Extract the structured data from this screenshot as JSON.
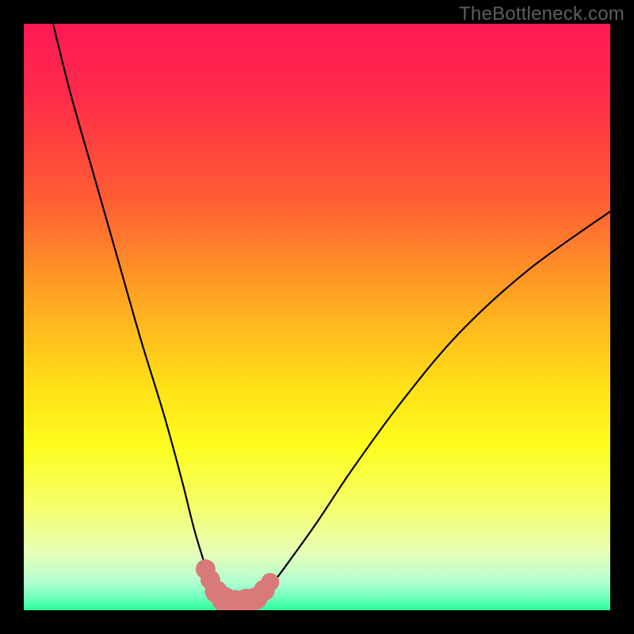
{
  "watermark": "TheBottleneck.com",
  "colors": {
    "frame": "#000000",
    "gradient_stops": [
      {
        "offset": 0.0,
        "color": "#ff1a55"
      },
      {
        "offset": 0.12,
        "color": "#ff2b4a"
      },
      {
        "offset": 0.3,
        "color": "#ff5d33"
      },
      {
        "offset": 0.5,
        "color": "#ffb31f"
      },
      {
        "offset": 0.62,
        "color": "#ffe018"
      },
      {
        "offset": 0.72,
        "color": "#fdfd1e"
      },
      {
        "offset": 0.82,
        "color": "#f5ff68"
      },
      {
        "offset": 0.9,
        "color": "#e6ffb8"
      },
      {
        "offset": 0.95,
        "color": "#b6ffd0"
      },
      {
        "offset": 0.975,
        "color": "#7affc0"
      },
      {
        "offset": 1.0,
        "color": "#2bff98"
      }
    ],
    "curve": "#000000",
    "marker_fill": "#d97a7a",
    "marker_stroke": "#b95c5c"
  },
  "chart_data": {
    "type": "line",
    "title": "",
    "xlabel": "",
    "ylabel": "",
    "xlim": [
      0,
      100
    ],
    "ylim": [
      0,
      100
    ],
    "series": [
      {
        "name": "left-curve",
        "x": [
          5,
          8,
          12,
          16,
          20,
          24,
          27,
          29,
          30.5,
          31.5,
          32.5,
          33.5
        ],
        "y": [
          100,
          88,
          74,
          60,
          46,
          33,
          22,
          14,
          9,
          6,
          3.5,
          1.8
        ]
      },
      {
        "name": "right-curve",
        "x": [
          40,
          42,
          45,
          50,
          56,
          64,
          74,
          86,
          100
        ],
        "y": [
          1.8,
          4,
          8,
          15,
          24,
          35,
          47,
          58,
          68
        ]
      },
      {
        "name": "valley-flat",
        "x": [
          33.5,
          35,
          37,
          38.5,
          40
        ],
        "y": [
          1.8,
          1.4,
          1.2,
          1.4,
          1.8
        ]
      }
    ],
    "markers": [
      {
        "x": 31.0,
        "y": 7.0,
        "r": 1.4
      },
      {
        "x": 31.8,
        "y": 5.2,
        "r": 1.4
      },
      {
        "x": 32.8,
        "y": 3.2,
        "r": 1.6
      },
      {
        "x": 34.2,
        "y": 1.8,
        "r": 1.8
      },
      {
        "x": 36.0,
        "y": 1.3,
        "r": 1.8
      },
      {
        "x": 38.0,
        "y": 1.5,
        "r": 1.8
      },
      {
        "x": 39.6,
        "y": 2.0,
        "r": 1.6
      },
      {
        "x": 41.0,
        "y": 3.4,
        "r": 1.5
      },
      {
        "x": 42.0,
        "y": 4.8,
        "r": 1.3
      }
    ]
  }
}
